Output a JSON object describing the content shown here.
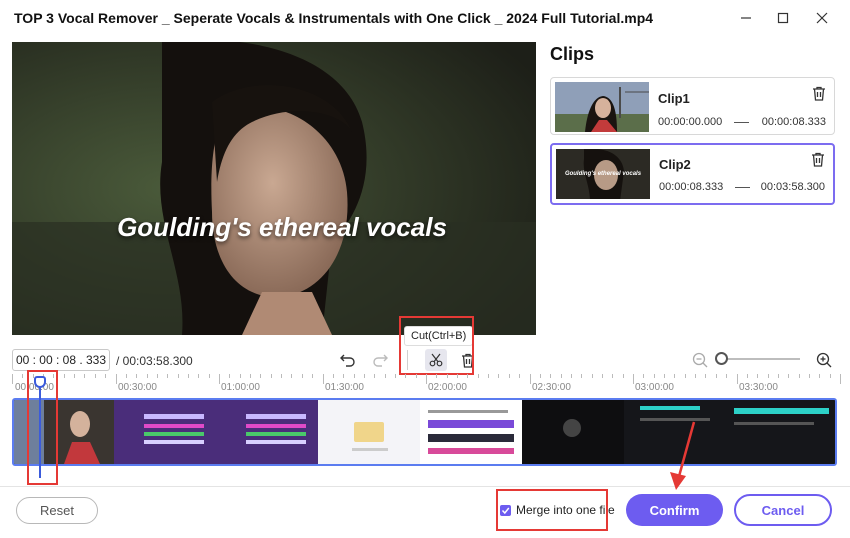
{
  "window": {
    "title": "TOP 3 Vocal Remover _ Seperate Vocals & Instrumentals with One Click _ 2024 Full Tutorial.mp4"
  },
  "preview": {
    "caption": "Goulding's ethereal vocals"
  },
  "clips": {
    "heading": "Clips",
    "items": [
      {
        "name": "Clip1",
        "start": "00:00:00.000",
        "end": "00:00:08.333",
        "thumb_caption": ""
      },
      {
        "name": "Clip2",
        "start": "00:00:08.333",
        "end": "00:03:58.300",
        "thumb_caption": "Goulding's ethereal vocals"
      }
    ]
  },
  "toolbar": {
    "timecode": "00 : 00 : 08 . 333",
    "duration": "/ 00:03:58.300",
    "cut_tooltip": "Cut(Ctrl+B)",
    "zoom_level": 0
  },
  "ruler": {
    "labels": [
      "00:00:00",
      "00:30:00",
      "01:00:00",
      "01:30:00",
      "02:00:00",
      "02:30:00",
      "03:00:00",
      "03:30:00"
    ]
  },
  "footer": {
    "reset_label": "Reset",
    "merge_label": "Merge into one file",
    "merge_checked": true,
    "confirm_label": "Confirm",
    "cancel_label": "Cancel"
  },
  "colors": {
    "accent": "#6d5cf0",
    "annotation": "#e53935",
    "playhead": "#3b5bdb"
  }
}
